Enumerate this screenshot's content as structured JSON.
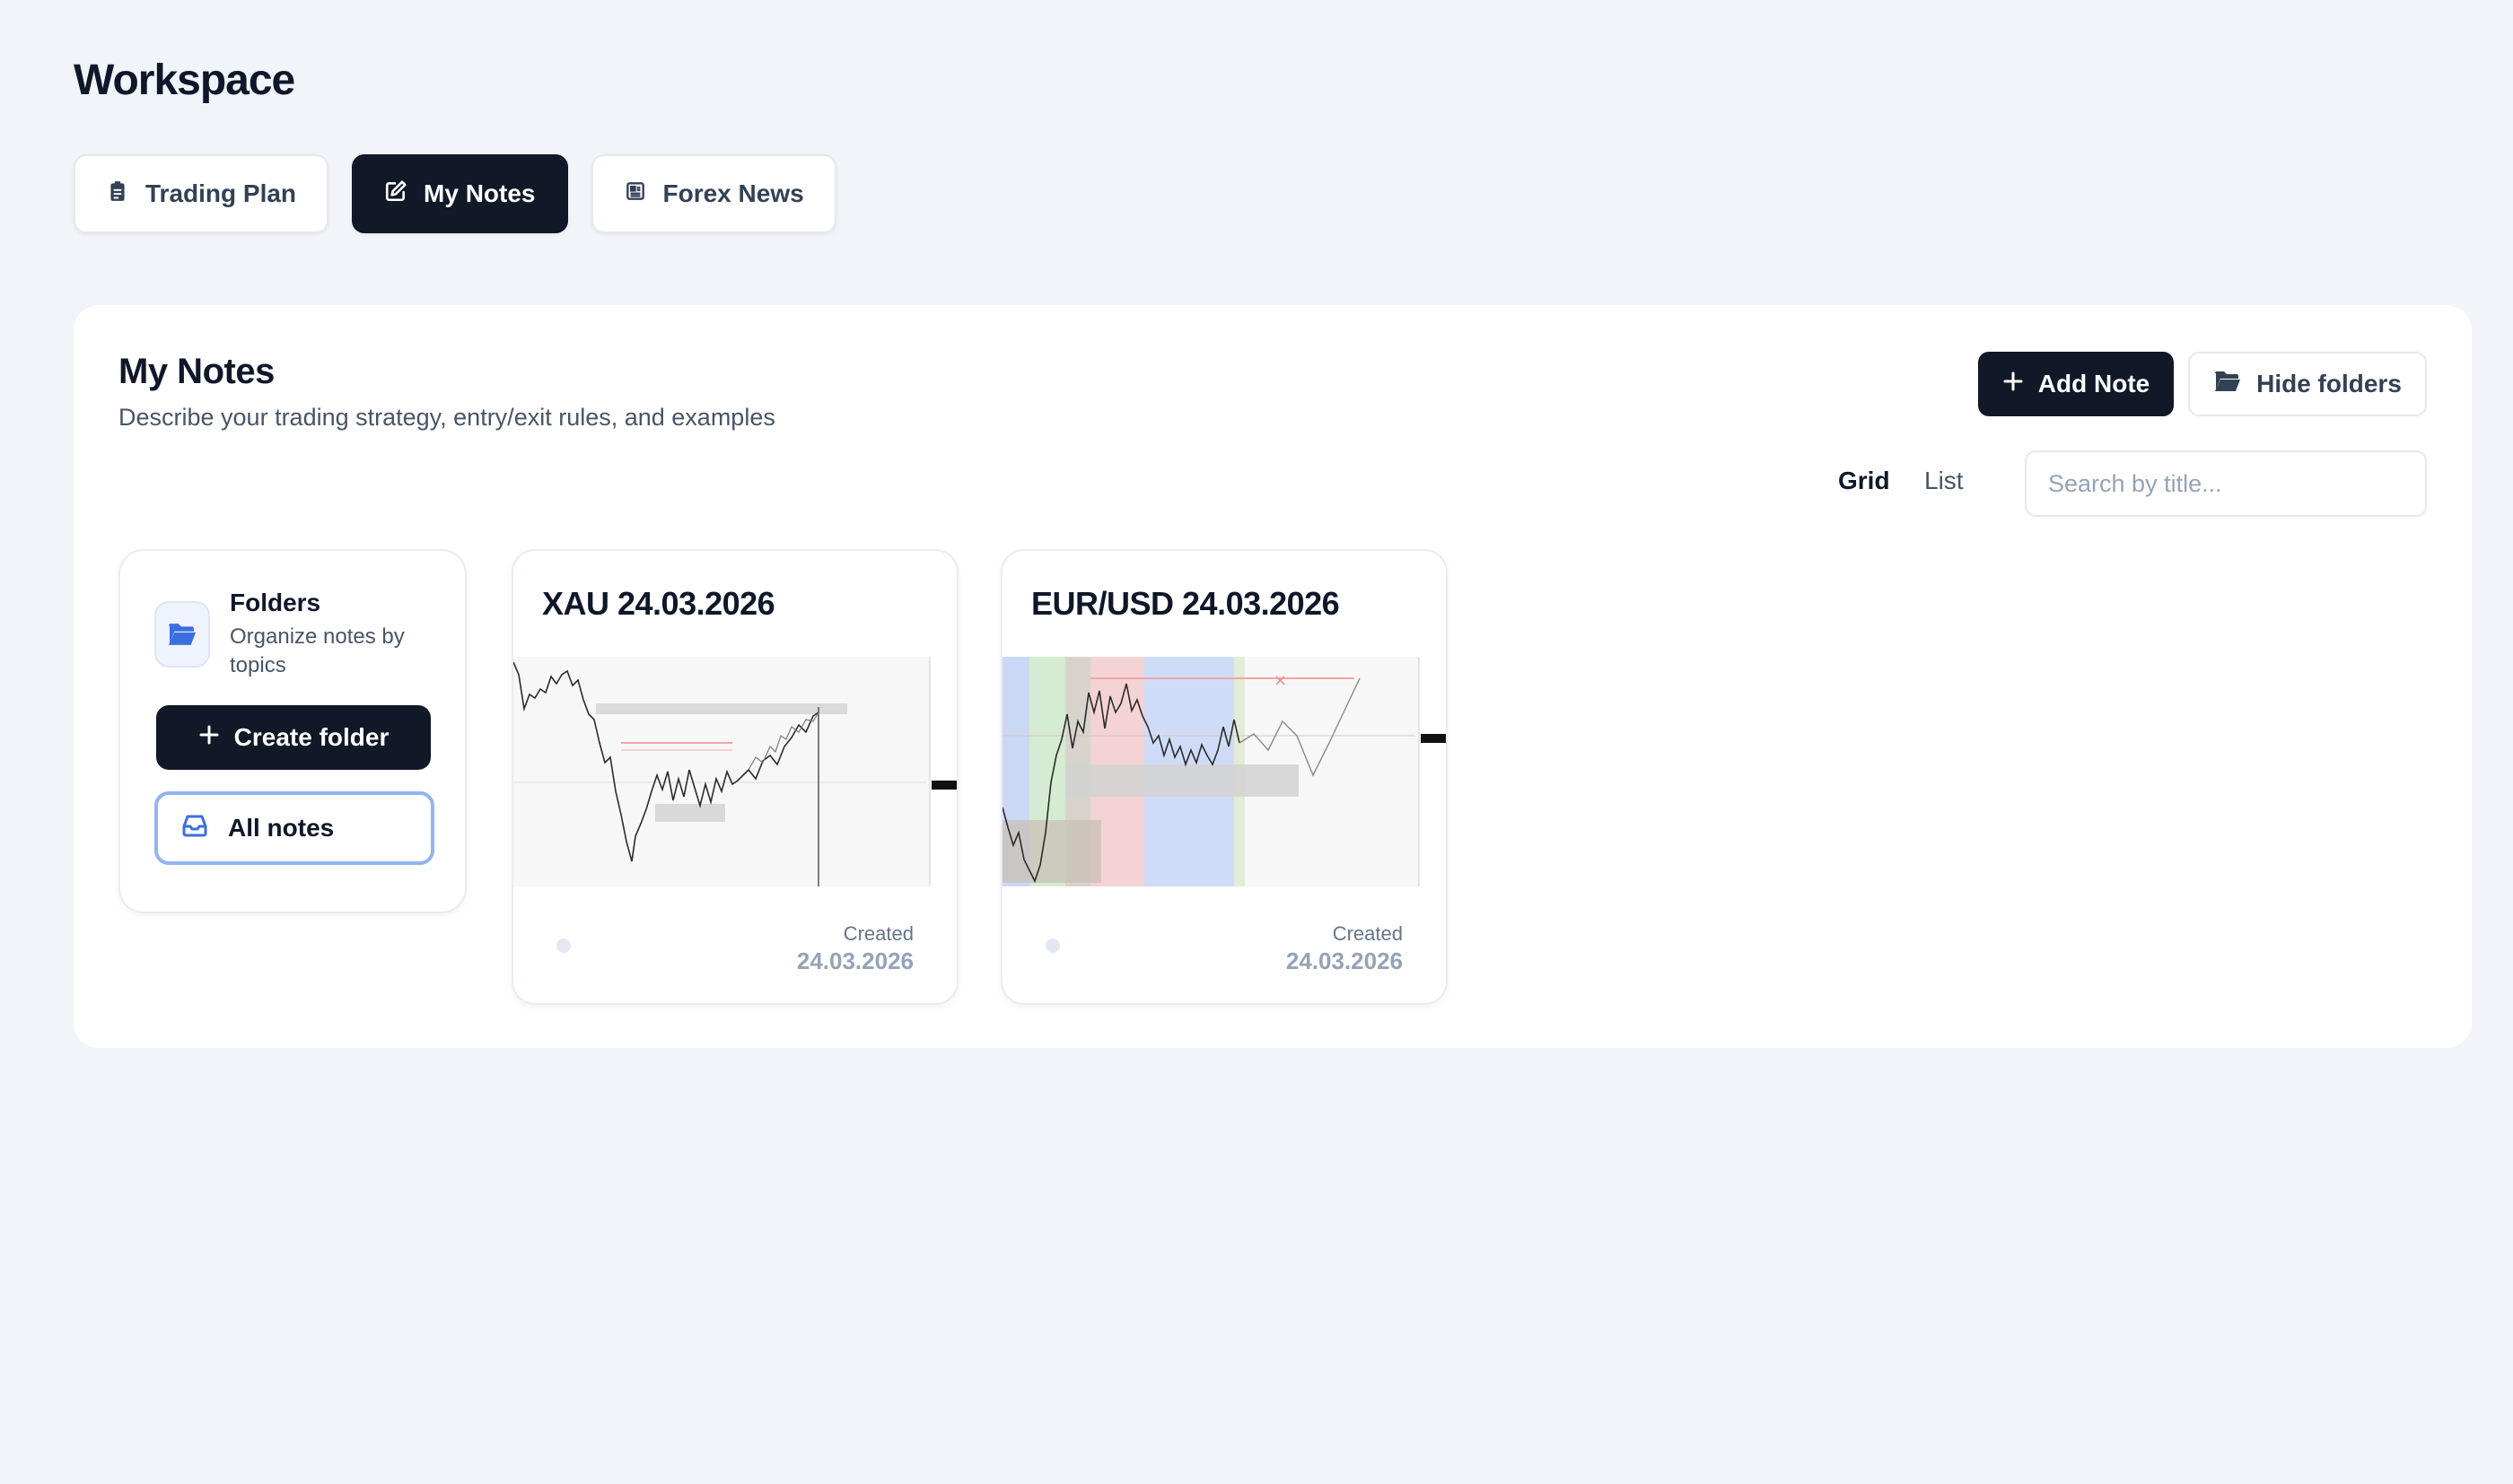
{
  "workspace": {
    "title": "Workspace",
    "tabs": [
      {
        "label": "Trading Plan",
        "icon": "clipboard-icon",
        "active": false
      },
      {
        "label": "My Notes",
        "icon": "edit-icon",
        "active": true
      },
      {
        "label": "Forex News",
        "icon": "newspaper-icon",
        "active": false
      }
    ]
  },
  "panel": {
    "title": "My Notes",
    "subtitle": "Describe your trading strategy, entry/exit rules, and examples",
    "add_note_label": "Add Note",
    "hide_folders_label": "Hide folders",
    "view": {
      "grid_label": "Grid",
      "list_label": "List",
      "selected": "Grid"
    },
    "search": {
      "placeholder": "Search by title...",
      "value": ""
    }
  },
  "folders": {
    "title": "Folders",
    "description": "Organize notes by topics",
    "create_label": "Create folder",
    "all_notes_label": "All notes"
  },
  "notes": [
    {
      "title": "XAU 24.03.2026",
      "created_label": "Created",
      "created_date": "24.03.2026",
      "thumbnail": "gold-price-chart-screenshot"
    },
    {
      "title": "EUR/USD 24.03.2026",
      "created_label": "Created",
      "created_date": "24.03.2026",
      "thumbnail": "eurusd-price-chart-screenshot"
    }
  ],
  "colors": {
    "background": "#f1f4f8",
    "dark_button": "#111827",
    "accent_blue": "#3b6fe0",
    "selected_border": "#93b4ef"
  }
}
